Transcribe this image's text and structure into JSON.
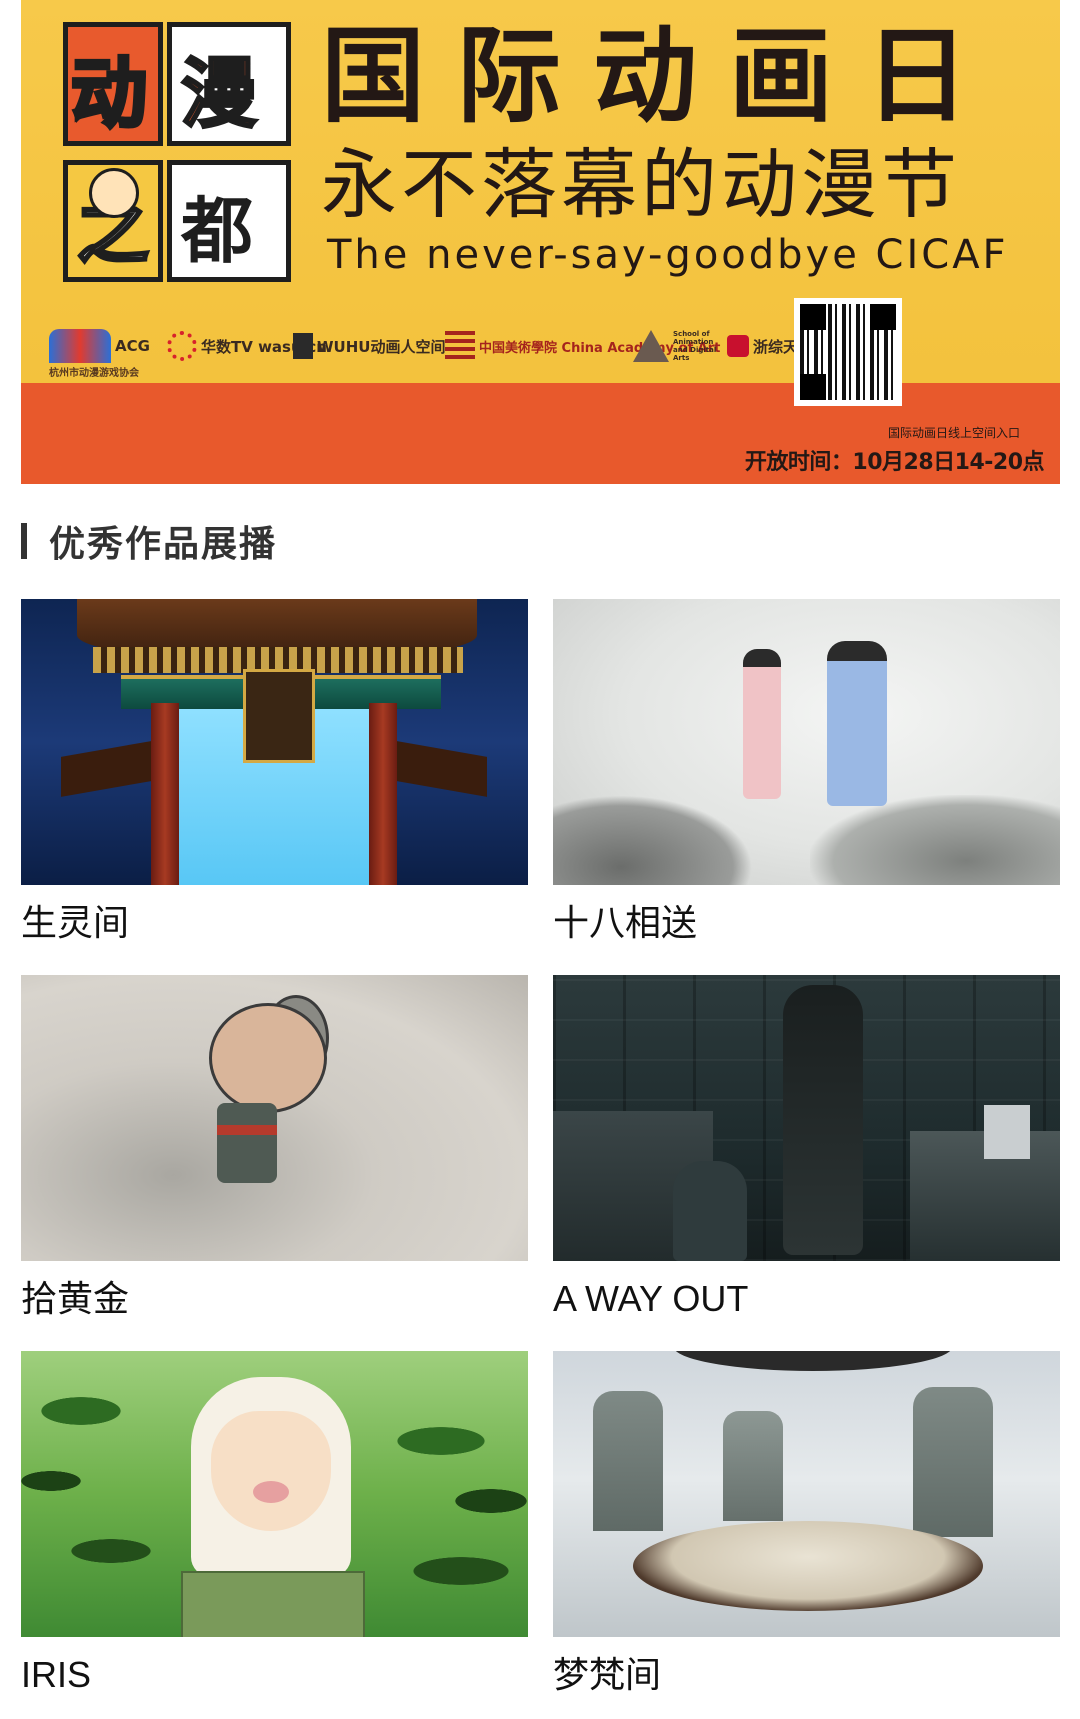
{
  "banner": {
    "logo_chars": [
      "动",
      "漫",
      "之",
      "都"
    ],
    "title": "国际动画日",
    "subtitle": "永不落幕的动漫节",
    "english": "The never-say-goodbye CICAF",
    "sponsors": [
      {
        "label": "ACG",
        "caption": "杭州市动漫游戏协会"
      },
      {
        "label": "华数TV wasu.cn"
      },
      {
        "label": "WUHU动画人空间"
      },
      {
        "label": "中国美術學院 China Academy of Art"
      },
      {
        "label": "School of Animation and Digital Arts"
      },
      {
        "label": "浙综天地"
      }
    ],
    "qr_caption": "国际动画日线上空间入口",
    "open_time": "开放时间：10月28日14-20点",
    "colors": {
      "top": "#f6c544",
      "bottom": "#e8592c",
      "text": "#231815"
    }
  },
  "section": {
    "title": "优秀作品展播"
  },
  "works": [
    {
      "title": "生灵间"
    },
    {
      "title": "十八相送"
    },
    {
      "title": "拾黄金"
    },
    {
      "title": "A WAY OUT"
    },
    {
      "title": "IRIS"
    },
    {
      "title": "梦梵间"
    }
  ]
}
